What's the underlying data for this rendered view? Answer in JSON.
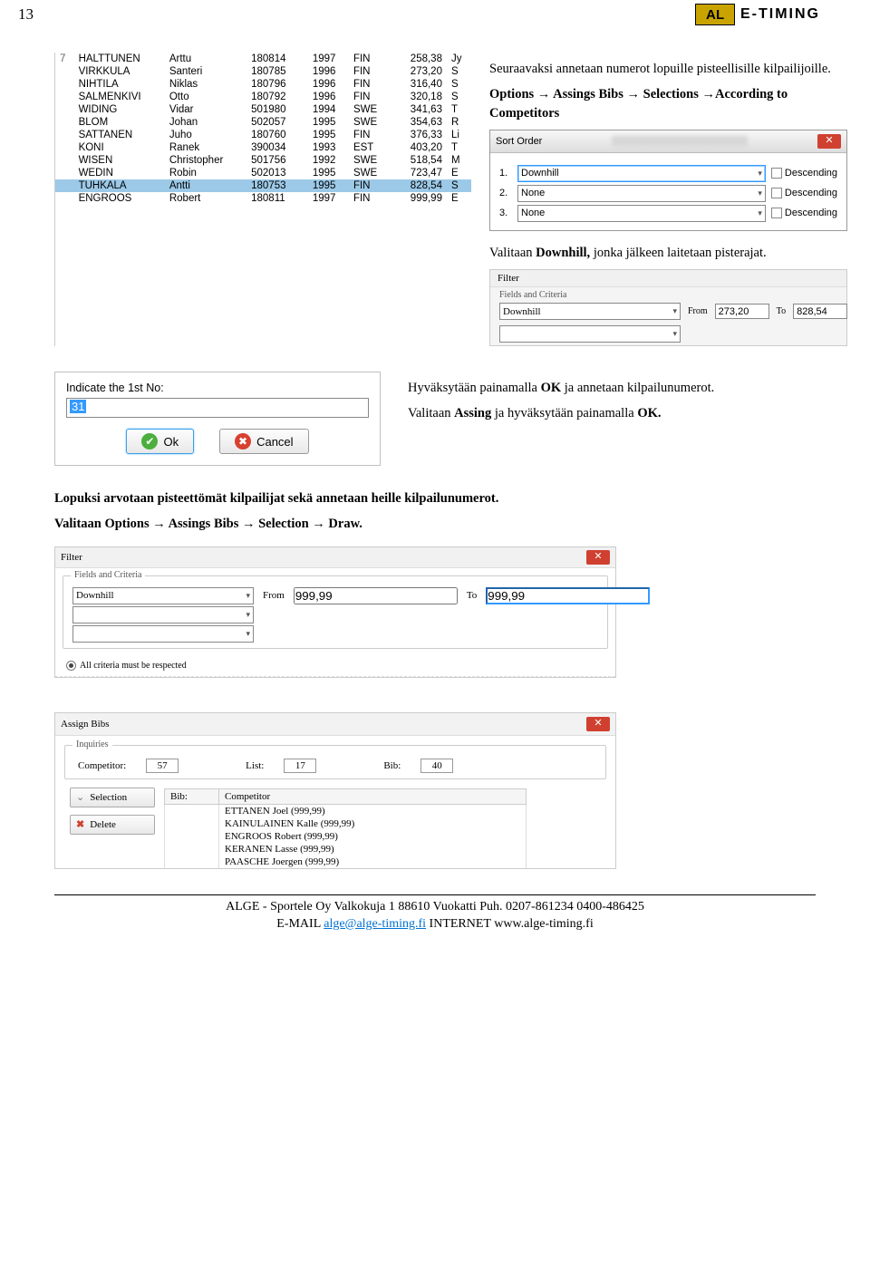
{
  "page_number": "13",
  "logo_text": "E-TIMING",
  "intro": {
    "p1": "Seuraavaksi annetaan numerot lopuille pisteellisille kilpailijoille.",
    "p2a": "Options → Assings Bibs → Selections →According to Competitors",
    "p3a": "Valitaan ",
    "p3b": "Downhill,",
    "p3c": " jonka jälkeen laitetaan pisterajat."
  },
  "competitors": [
    {
      "idx": "7",
      "last": "HALTTUNEN",
      "first": "Arttu",
      "code": "180814",
      "yr": "1997",
      "nat": "FIN",
      "pts": "258,38",
      "g": "Jy",
      "sel": false
    },
    {
      "idx": "",
      "last": "VIRKKULA",
      "first": "Santeri",
      "code": "180785",
      "yr": "1996",
      "nat": "FIN",
      "pts": "273,20",
      "g": "S",
      "sel": false
    },
    {
      "idx": "",
      "last": "NIHTILA",
      "first": "Niklas",
      "code": "180796",
      "yr": "1996",
      "nat": "FIN",
      "pts": "316,40",
      "g": "S",
      "sel": false
    },
    {
      "idx": "",
      "last": "SALMENKIVI",
      "first": "Otto",
      "code": "180792",
      "yr": "1996",
      "nat": "FIN",
      "pts": "320,18",
      "g": "S",
      "sel": false
    },
    {
      "idx": "",
      "last": "WIDING",
      "first": "Vidar",
      "code": "501980",
      "yr": "1994",
      "nat": "SWE",
      "pts": "341,63",
      "g": "T",
      "sel": false
    },
    {
      "idx": "",
      "last": "BLOM",
      "first": "Johan",
      "code": "502057",
      "yr": "1995",
      "nat": "SWE",
      "pts": "354,63",
      "g": "R",
      "sel": false
    },
    {
      "idx": "",
      "last": "SATTANEN",
      "first": "Juho",
      "code": "180760",
      "yr": "1995",
      "nat": "FIN",
      "pts": "376,33",
      "g": "Li",
      "sel": false
    },
    {
      "idx": "",
      "last": "KONI",
      "first": "Ranek",
      "code": "390034",
      "yr": "1993",
      "nat": "EST",
      "pts": "403,20",
      "g": "T",
      "sel": false
    },
    {
      "idx": "",
      "last": "WISEN",
      "first": "Christopher",
      "code": "501756",
      "yr": "1992",
      "nat": "SWE",
      "pts": "518,54",
      "g": "M",
      "sel": false
    },
    {
      "idx": "",
      "last": "WEDIN",
      "first": "Robin",
      "code": "502013",
      "yr": "1995",
      "nat": "SWE",
      "pts": "723,47",
      "g": "E",
      "sel": false
    },
    {
      "idx": "",
      "last": "TUHKALA",
      "first": "Antti",
      "code": "180753",
      "yr": "1995",
      "nat": "FIN",
      "pts": "828,54",
      "g": "S",
      "sel": true
    },
    {
      "idx": "",
      "last": "ENGROOS",
      "first": "Robert",
      "code": "180811",
      "yr": "1997",
      "nat": "FIN",
      "pts": "999,99",
      "g": "E",
      "sel": false
    }
  ],
  "sort_dialog": {
    "title": "Sort Order",
    "rows": [
      {
        "n": "1.",
        "value": "Downhill",
        "sel": true
      },
      {
        "n": "2.",
        "value": "None",
        "sel": false
      },
      {
        "n": "3.",
        "value": "None",
        "sel": false
      }
    ],
    "desc_label": "Descending"
  },
  "filter1": {
    "title": "Filter",
    "group": "Fields and Criteria",
    "field": "Downhill",
    "from_label": "From",
    "from": "273,20",
    "to_label": "To",
    "to": "828,54"
  },
  "ok_block": {
    "p1a": "Hyväksytään painamalla ",
    "p1b": "OK",
    "p1c": " ja annetaan kilpailunumerot.",
    "p2a": "Valitaan ",
    "p2b": "Assing",
    "p2c": " ja hyväksytään painamalla ",
    "p2d": "OK.",
    "dlg_label": "Indicate the 1st No:",
    "dlg_value": "31",
    "ok": "Ok",
    "cancel": "Cancel"
  },
  "mid": {
    "p1": "Lopuksi arvotaan pisteettömät kilpailijat sekä annetaan heille kilpailunumerot.",
    "p2": "Valitaan Options → Assings Bibs → Selection → Draw."
  },
  "filter2": {
    "title": "Filter",
    "group": "Fields and Criteria",
    "field": "Downhill",
    "from_label": "From",
    "from": "999,99",
    "to_label": "To",
    "to": "999,99",
    "radio": "All criteria must be respected"
  },
  "assign": {
    "title": "Assign Bibs",
    "group": "Inquiries",
    "comp_label": "Competitor:",
    "comp_val": "57",
    "list_label": "List:",
    "list_val": "17",
    "bib_label": "Bib:",
    "bib_val": "40",
    "th_bib": "Bib:",
    "th_comp": "Competitor",
    "btn_sel": "Selection",
    "btn_del": "Delete",
    "rows": [
      "ETTANEN Joel (999,99)",
      "KAINULAINEN Kalle (999,99)",
      "ENGROOS Robert (999,99)",
      "KERANEN Lasse (999,99)",
      "PAASCHE Joergen (999,99)"
    ]
  },
  "footer": {
    "l1": "ALGE - Sportele Oy Valkokuja 1 88610 Vuokatti  Puh. 0207-861234  0400-486425",
    "l2a": "E-MAIL ",
    "l2b": "alge@alge-timing.fi",
    "l2c": "  INTERNET  www.alge-timing.fi"
  }
}
